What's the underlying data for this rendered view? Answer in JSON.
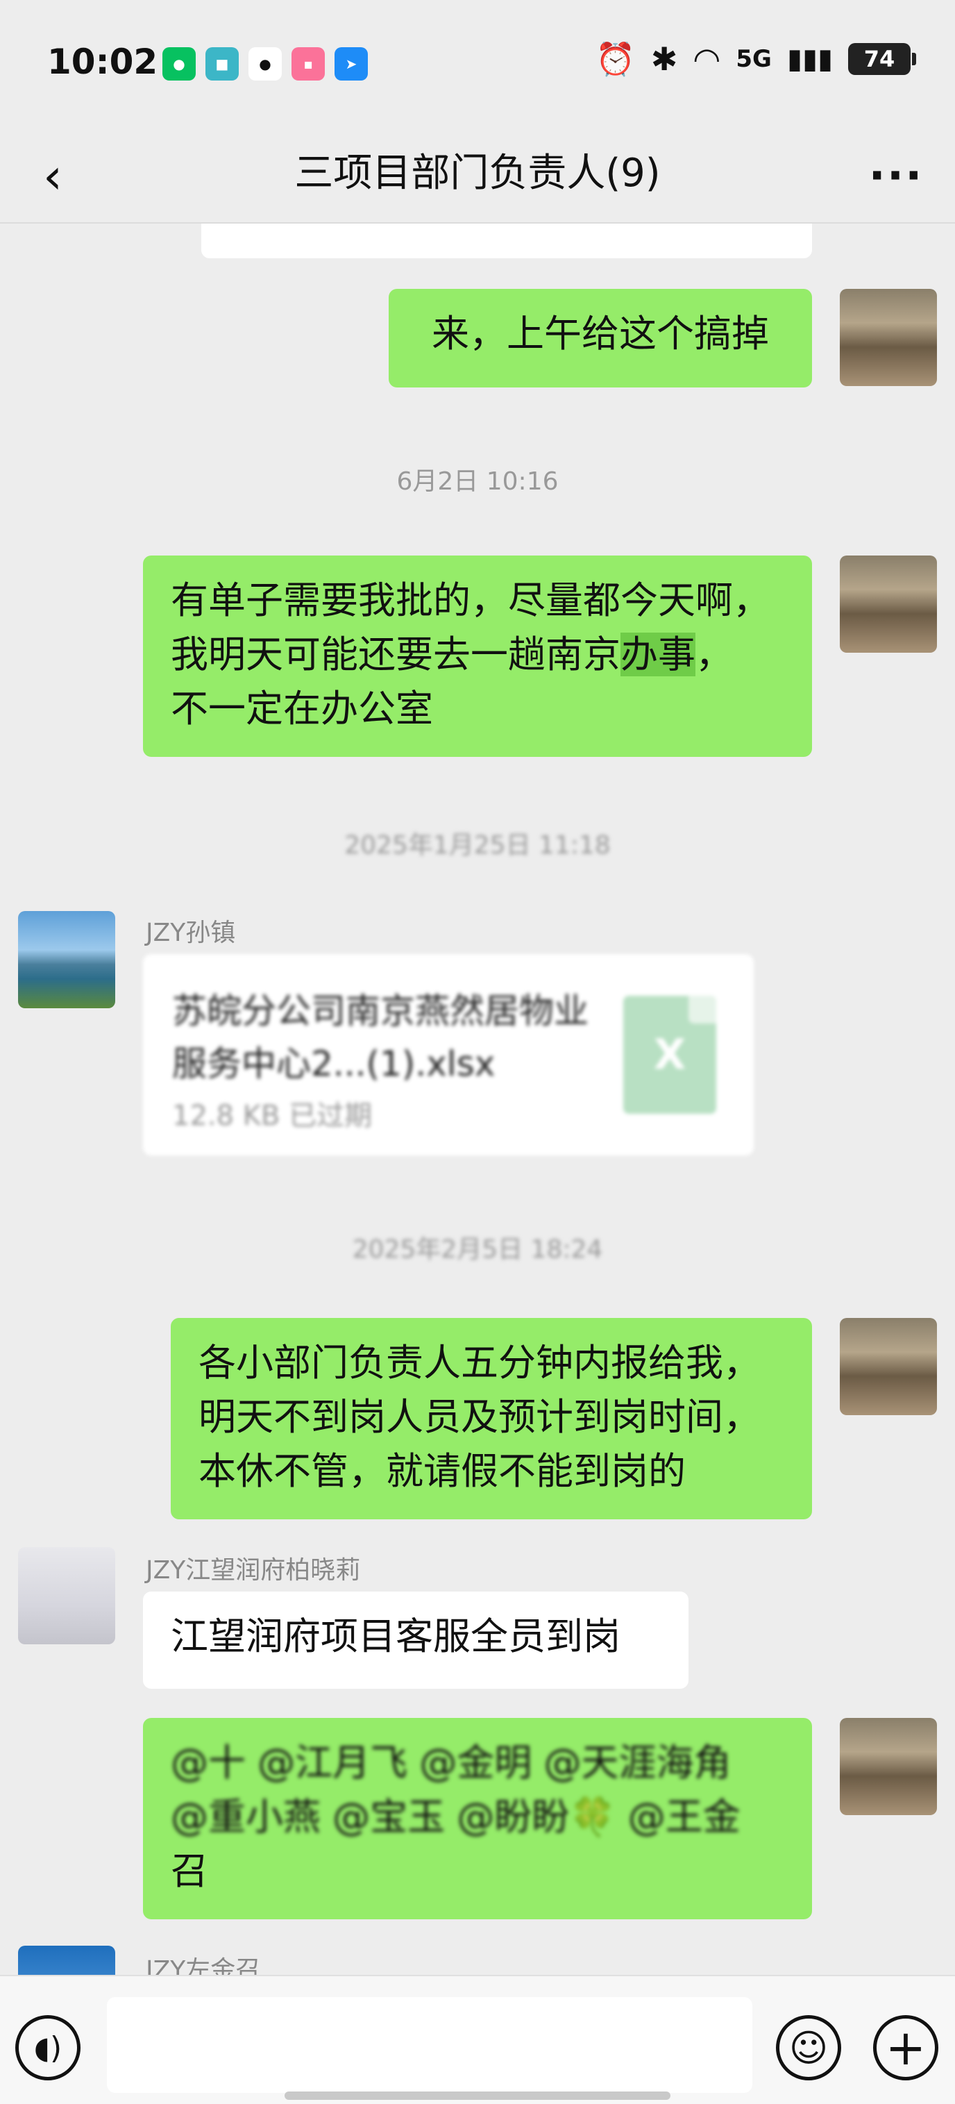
{
  "status_bar": {
    "time": "10:02",
    "apps": [
      {
        "name": "wechat-icon",
        "label": "",
        "color": "#07c160"
      },
      {
        "name": "app2-icon",
        "label": "",
        "color": "#3cb6c7"
      },
      {
        "name": "qq-icon",
        "label": "",
        "color": "#111111"
      },
      {
        "name": "bilibili-icon",
        "label": "",
        "color": "#fb7299"
      },
      {
        "name": "dingtalk-icon",
        "label": "",
        "color": "#1e8cf7"
      }
    ],
    "network": "5G",
    "battery": "74"
  },
  "header": {
    "title": "三项目部门负责人(9)"
  },
  "messages": {
    "m1_cut": "",
    "m2": "来，上午给这个搞掉",
    "ts1": "6月2日 10:16",
    "m3_line1": "有单子需要我批的，尽量都今天啊，",
    "m3_line2a": "我明天可能还要去一趟南京",
    "m3_line2b": "办事",
    "m3_line2c": "，",
    "m3_line3": "不一定在办公室",
    "ts2": "2025年1月25日 11:18",
    "sender1": "JZY孙镇",
    "file_name": "苏皖分公司南京燕然居物业服务中心2...(1).xlsx",
    "file_meta": "12.8 KB  已过期",
    "file_ext": "X",
    "ts3": "2025年2月5日 18:24",
    "m4_line1": "各小部门负责人五分钟内报给我，",
    "m4_line2": "明天不到岗人员及预计到岗时间，",
    "m4_line3": "本休不管，就请假不能到岗的",
    "sender2": "JZY江望润府柏晓莉",
    "m5": "江望润府项目客服全员到岗",
    "m6_line1": "@十  @江月飞  @金明  @天涯海角",
    "m6_line2": "@重小燕  @宝玉  @盼盼🍀  @王金",
    "m6_line3": "召",
    "sender3": "JZY左金召"
  }
}
